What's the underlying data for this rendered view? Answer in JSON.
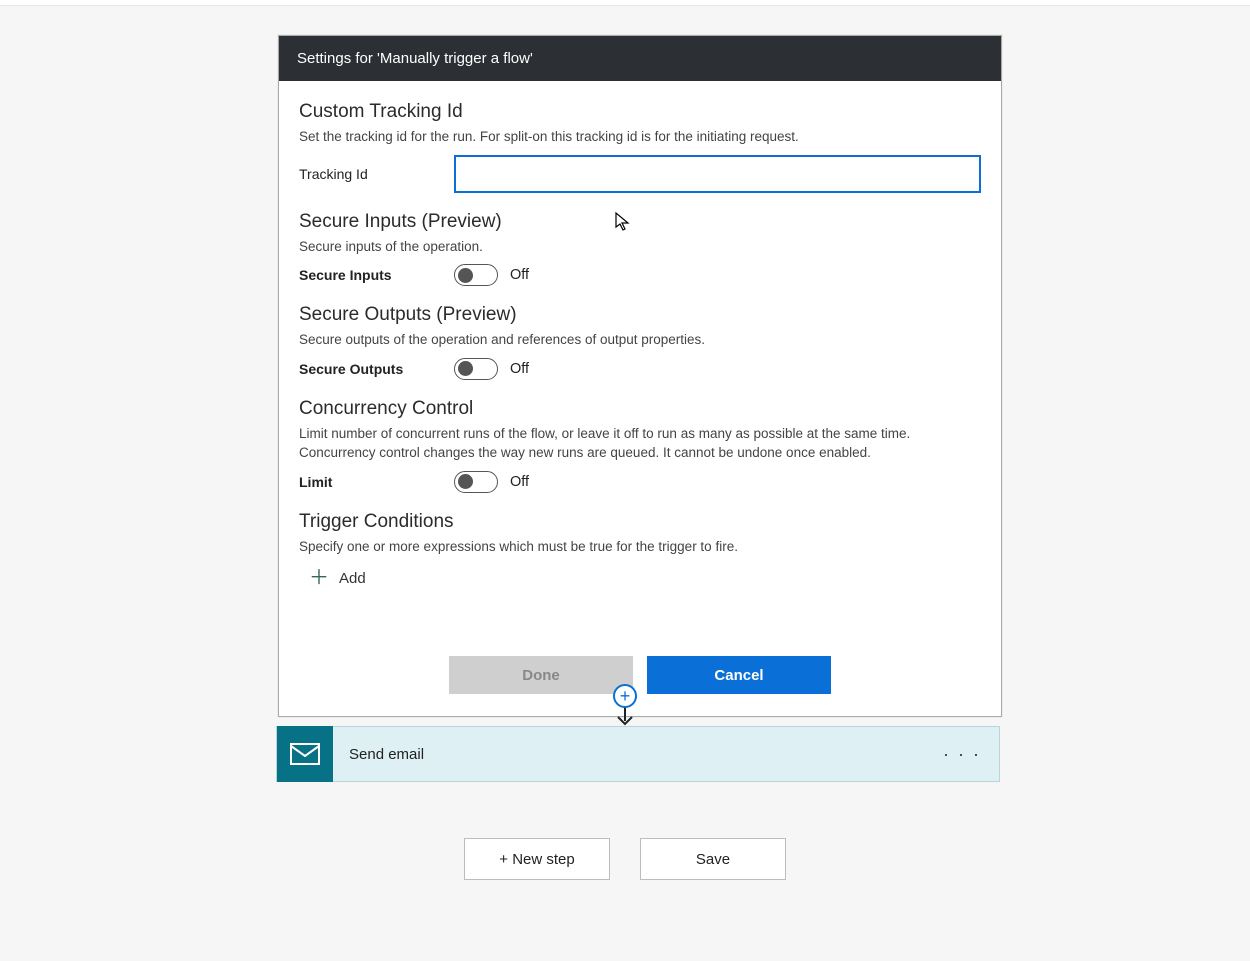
{
  "header": {
    "title": "Settings for 'Manually trigger a flow'"
  },
  "sections": {
    "tracking": {
      "title": "Custom Tracking Id",
      "desc": "Set the tracking id for the run. For split-on this tracking id is for the initiating request.",
      "label": "Tracking Id",
      "value": ""
    },
    "secureInputs": {
      "title": "Secure Inputs (Preview)",
      "desc": "Secure inputs of the operation.",
      "label": "Secure Inputs",
      "state": "Off"
    },
    "secureOutputs": {
      "title": "Secure Outputs (Preview)",
      "desc": "Secure outputs of the operation and references of output properties.",
      "label": "Secure Outputs",
      "state": "Off"
    },
    "concurrency": {
      "title": "Concurrency Control",
      "desc": "Limit number of concurrent runs of the flow, or leave it off to run as many as possible at the same time. Concurrency control changes the way new runs are queued. It cannot be undone once enabled.",
      "label": "Limit",
      "state": "Off"
    },
    "triggerConditions": {
      "title": "Trigger Conditions",
      "desc": "Specify one or more expressions which must be true for the trigger to fire.",
      "addLabel": "Add"
    }
  },
  "footer": {
    "done": "Done",
    "cancel": "Cancel"
  },
  "card": {
    "title": "Send email"
  },
  "bottom": {
    "newStep": "+ New step",
    "save": "Save"
  }
}
